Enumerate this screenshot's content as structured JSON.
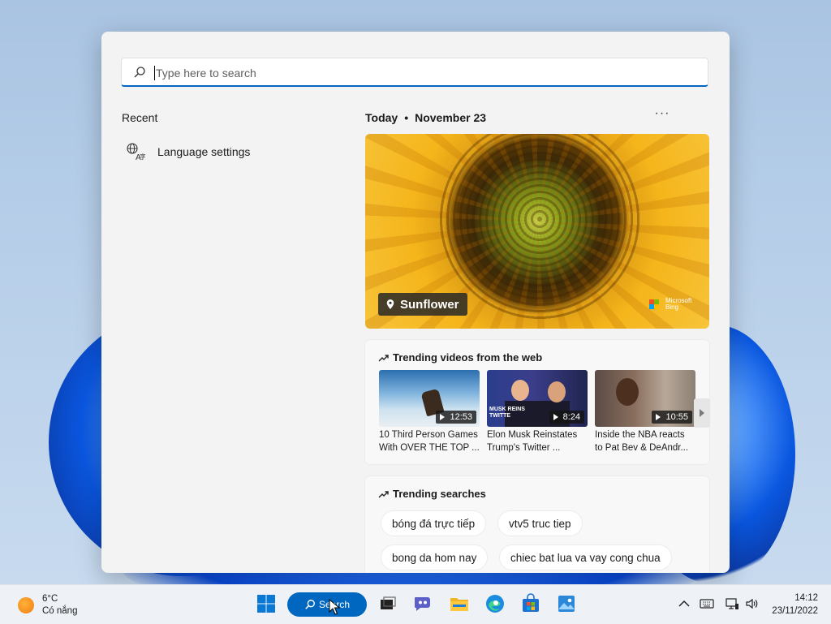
{
  "search": {
    "placeholder": "Type here to search",
    "value": ""
  },
  "recent": {
    "title": "Recent",
    "items": [
      {
        "label": "Language settings",
        "icon": "language-icon"
      }
    ]
  },
  "today": {
    "label": "Today",
    "separator": "•",
    "date": "November 23",
    "more_label": "···"
  },
  "hero": {
    "label": "Sunflower",
    "brand_line1": "Microsoft",
    "brand_line2": "Bing"
  },
  "trending_videos": {
    "title": "Trending videos from the web",
    "items": [
      {
        "duration": "12:53",
        "title_line1": "10 Third Person Games",
        "title_line2": "With OVER THE TOP ..."
      },
      {
        "duration": "8:24",
        "title_line1": "Elon Musk Reinstates",
        "title_line2": "Trump's Twitter ...",
        "thumb_text_line1": "MUSK REINS",
        "thumb_text_line2": "TWITTE"
      },
      {
        "duration": "10:55",
        "title_line1": "Inside the NBA reacts",
        "title_line2": "to Pat Bev & DeAndr..."
      }
    ]
  },
  "trending_searches": {
    "title": "Trending searches",
    "items": [
      "bóng đá trực tiếp",
      "vtv5 truc tiep",
      "bong da hom nay",
      "chiec bat lua va vay cong chua"
    ]
  },
  "taskbar": {
    "weather": {
      "temp": "6°C",
      "condition": "Có nắng"
    },
    "search_label": "Search",
    "clock": {
      "time": "14:12",
      "date": "23/11/2022"
    }
  },
  "colors": {
    "accent": "#0067c0",
    "panel_bg": "#f3f3f3",
    "taskbar_bg": "#eef2f7"
  }
}
